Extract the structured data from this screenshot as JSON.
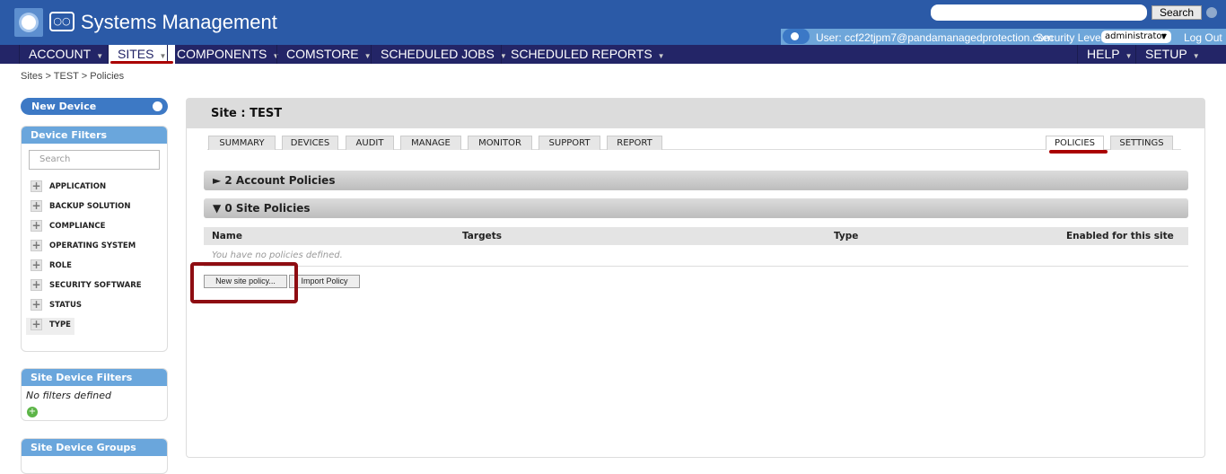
{
  "header": {
    "app_title": "Systems Management",
    "search_placeholder": "",
    "search_button": "Search",
    "user": "User: ccf22tjpm7@pandamanagedprotection.com",
    "security_label": "Security Level:",
    "security_value": "administrator",
    "logout": "Log Out"
  },
  "nav": {
    "items": [
      {
        "label": "ACCOUNT"
      },
      {
        "label": "SITES",
        "active": true
      },
      {
        "label": "COMPONENTS"
      },
      {
        "label": "COMSTORE"
      },
      {
        "label": "SCHEDULED JOBS"
      },
      {
        "label": "SCHEDULED REPORTS"
      }
    ],
    "right": [
      {
        "label": "HELP"
      },
      {
        "label": "SETUP"
      }
    ]
  },
  "breadcrumb": "Sites > TEST > Policies",
  "sidebar": {
    "new_device": "New Device",
    "device_filters": {
      "title": "Device Filters",
      "search_placeholder": "Search",
      "items": [
        "APPLICATION",
        "BACKUP SOLUTION",
        "COMPLIANCE",
        "OPERATING SYSTEM",
        "ROLE",
        "SECURITY SOFTWARE",
        "STATUS",
        "TYPE"
      ]
    },
    "site_device_filters": {
      "title": "Site Device Filters",
      "empty": "No filters defined"
    },
    "site_device_groups": {
      "title": "Site Device Groups"
    }
  },
  "main": {
    "title": "Site : TEST",
    "tabs": [
      "SUMMARY",
      "DEVICES",
      "AUDIT",
      "MANAGE",
      "MONITOR",
      "SUPPORT",
      "REPORT"
    ],
    "right_tabs": [
      "POLICIES",
      "SETTINGS"
    ],
    "active_tab": "POLICIES",
    "account_policies": "► 2 Account Policies",
    "site_policies": "▼ 0 Site Policies",
    "columns": [
      "Name",
      "Targets",
      "Type",
      "Enabled for this site"
    ],
    "empty": "You have no policies defined.",
    "buttons": {
      "new": "New site policy...",
      "import": "Import Policy"
    }
  },
  "colors": {
    "header": "#2b5aa7",
    "nav": "#232567",
    "highlight": "#8e0d12"
  }
}
